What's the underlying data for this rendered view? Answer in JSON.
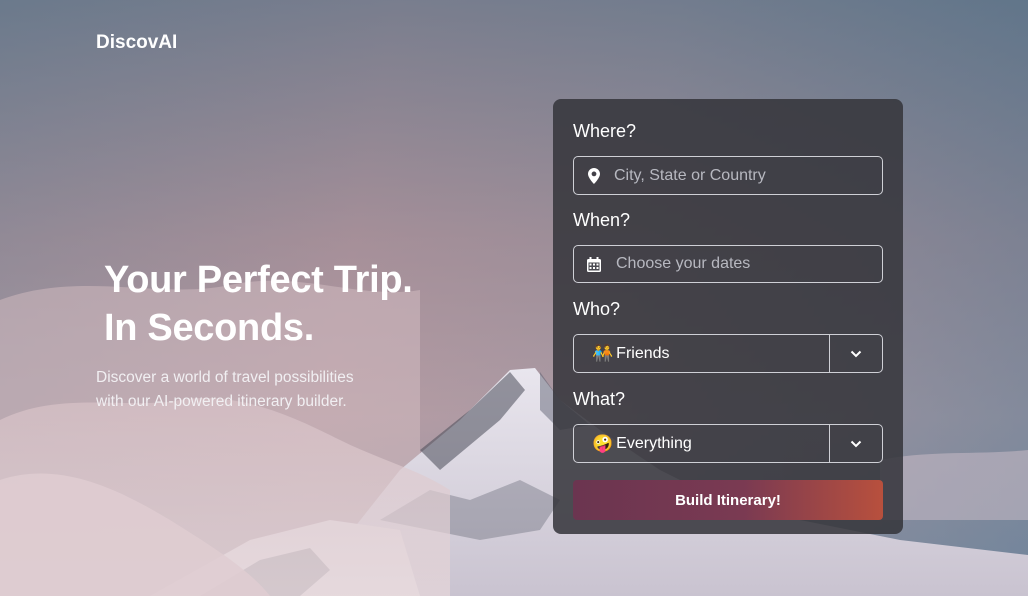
{
  "brand": {
    "name": "DiscovAI"
  },
  "hero": {
    "title_line1": "Your Perfect Trip.",
    "title_line2": "In Seconds.",
    "subtitle_line1": "Discover a world of travel possibilities",
    "subtitle_line2": "with our AI-powered itinerary builder."
  },
  "form": {
    "where_label": "Where?",
    "where_placeholder": "City, State or Country",
    "when_label": "When?",
    "when_placeholder": "Choose your dates",
    "who_label": "Who?",
    "who_emoji": "🧑‍🤝‍🧑",
    "who_value": "Friends",
    "what_label": "What?",
    "what_emoji": "🤪",
    "what_value": "Everything",
    "submit_label": "Build Itinerary!"
  },
  "icons": {
    "where": "map-pin-icon",
    "when": "calendar-icon",
    "dropdown": "chevron-down-icon"
  },
  "colors": {
    "card_bg": "#34343a",
    "button_start": "#6b3550",
    "button_end": "#b8503d",
    "placeholder": "#b7b8c0"
  }
}
